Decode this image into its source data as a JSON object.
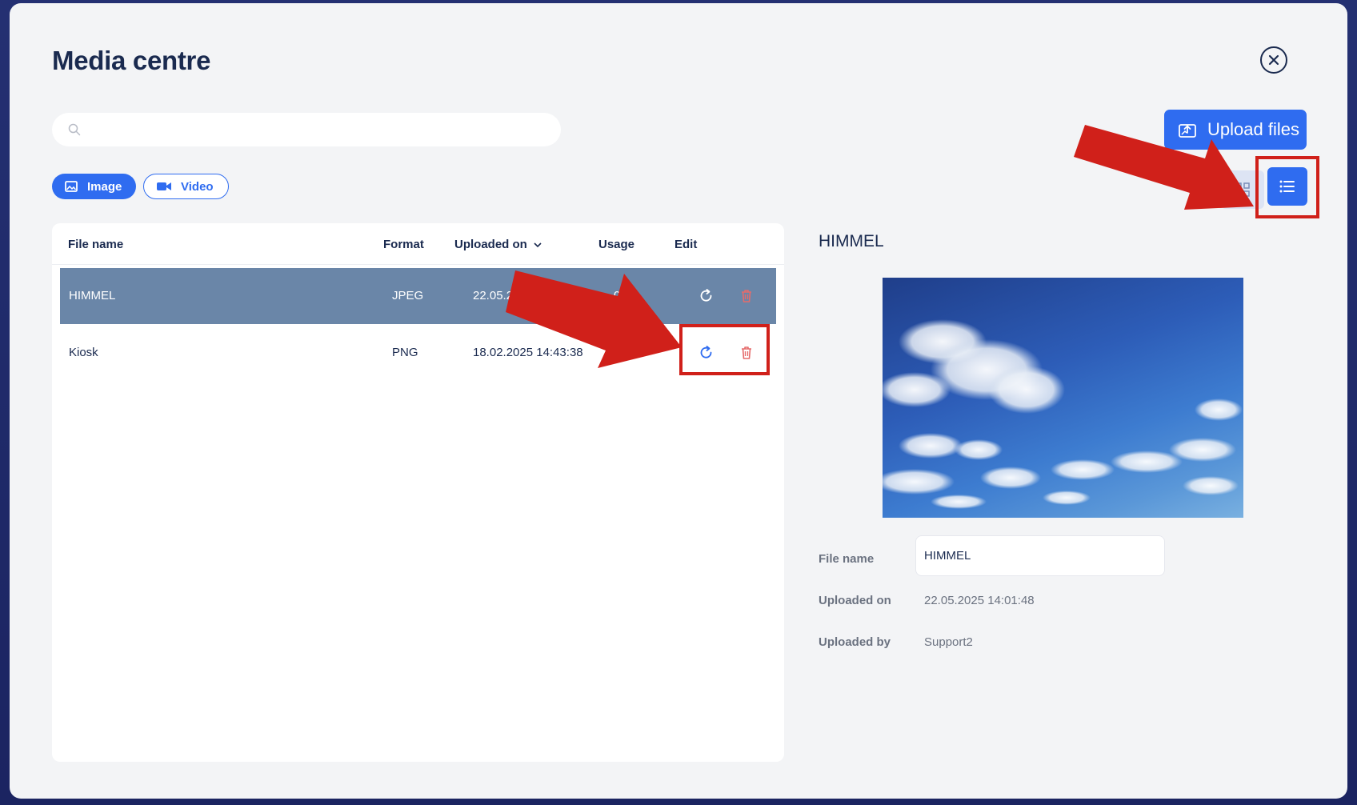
{
  "modal": {
    "title": "Media centre",
    "upload_label": "Upload files"
  },
  "search": {
    "placeholder": "",
    "value": ""
  },
  "filters": [
    {
      "label": "Image",
      "active": true
    },
    {
      "label": "Video",
      "active": false
    }
  ],
  "table": {
    "columns": [
      "File name",
      "Format",
      "Uploaded on",
      "Usage",
      "Edit"
    ],
    "rows": [
      {
        "name": "HIMMEL",
        "format": "JPEG",
        "uploaded": "22.05.2",
        "usage": "0",
        "selected": true
      },
      {
        "name": "Kiosk",
        "format": "PNG",
        "uploaded": "18.02.2025 14:43:38",
        "usage": "0",
        "selected": false
      }
    ]
  },
  "detail": {
    "title": "HIMMEL",
    "file_name_label": "File name",
    "file_name_value": "HIMMEL",
    "uploaded_on_label": "Uploaded on",
    "uploaded_on_value": "22.05.2025 14:01:48",
    "uploaded_by_label": "Uploaded by",
    "uploaded_by_value": "Support2"
  },
  "colors": {
    "accent": "#2f6cf0",
    "title": "#1a2a4f",
    "selected_row": "#6a86a8",
    "delete": "#e56b6b",
    "annotation": "#d0201a"
  },
  "icons": [
    "search-icon",
    "close-icon",
    "upload-icon",
    "image-icon",
    "video-icon",
    "grid-view-icon",
    "list-view-icon",
    "chevron-down-icon",
    "replace-icon",
    "trash-icon"
  ]
}
